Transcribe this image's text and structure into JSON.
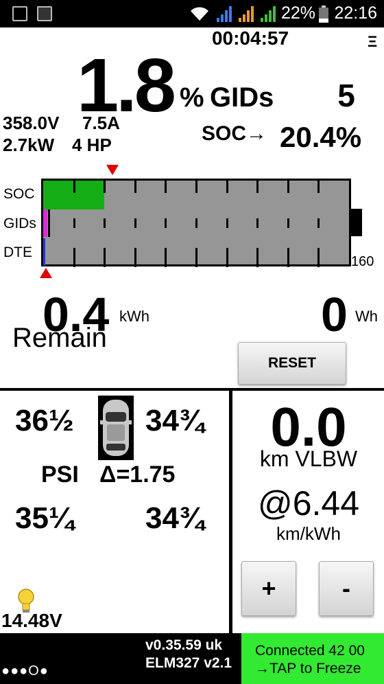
{
  "status_bar": {
    "battery_pct": "22%",
    "time": "22:16"
  },
  "timer": "00:04:57",
  "menu_icon_glyph": "Ξ",
  "gids": {
    "pct_value": "1.8",
    "pct_sign": "%",
    "label": "GIDs",
    "count": "5"
  },
  "readings": {
    "voltage": "358.0V",
    "current": "7.5A",
    "power": "2.7kW",
    "hp": "4 HP"
  },
  "soc": {
    "label": "SOC→",
    "value": "20.4%"
  },
  "gauge": {
    "rows": [
      "SOC",
      "GIDs",
      "DTE"
    ],
    "max_label": "160",
    "soc_fraction": 0.2,
    "gids_fraction": 0.013,
    "dte_fraction": 0.005,
    "colors": {
      "soc": "#15ad15",
      "gids": "#e028e0",
      "dte": "#1b3cd6",
      "marker": "#e00000",
      "bg": "#969696"
    }
  },
  "energy": {
    "remain_value": "0.4",
    "remain_unit": "kWh",
    "remain_label": "Remain",
    "used_value": "0",
    "used_unit": "Wh"
  },
  "reset_label": "RESET",
  "tires": {
    "front_left": "36½",
    "front_right": "34¾",
    "rear_left": "35¼",
    "rear_right": "34¾",
    "unit": "PSI",
    "delta": "Δ=1.75"
  },
  "aux_battery": "14.48V",
  "range": {
    "value": "0.0",
    "unit": "km VLBW",
    "efficiency": "@6.44",
    "efficiency_unit": "km/kWh"
  },
  "buttons": {
    "plus": "+",
    "minus": "-"
  },
  "footer": {
    "version": "v0.35.59 uk",
    "adapter": "ELM327 v2.1",
    "dots": "●●●O●",
    "connection_line1": "Connected 42 00",
    "connection_line2": "→TAP to Freeze"
  }
}
